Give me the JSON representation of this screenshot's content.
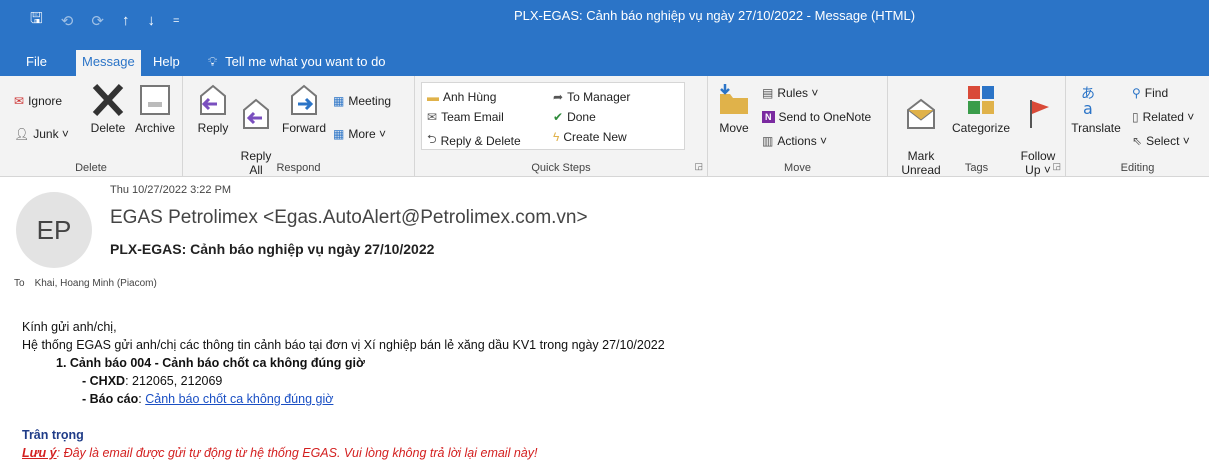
{
  "qat": {
    "save": "🖫",
    "undo": "⟲",
    "redo": "⟳",
    "up": "↑",
    "down": "↓",
    "more": "="
  },
  "window_title": "PLX-EGAS: Cảnh báo nghiệp vụ ngày 27/10/2022  -  Message (HTML)",
  "tabs": {
    "file": "File",
    "message": "Message",
    "help": "Help",
    "tell": "Tell me what you want to do"
  },
  "ribbon": {
    "delete_group": {
      "label": "Delete",
      "ignore": "Ignore",
      "junk": "Junk ˅",
      "delete": "Delete",
      "archive": "Archive"
    },
    "respond_group": {
      "label": "Respond",
      "reply": "Reply",
      "reply_all": "Reply\nAll",
      "forward": "Forward",
      "meeting": "Meeting",
      "more": "More ˅"
    },
    "quick_steps": {
      "label": "Quick Steps",
      "items": [
        "Anh Hùng",
        "Team Email",
        "Reply & Delete",
        "To Manager",
        "Done",
        "Create New"
      ]
    },
    "move_group": {
      "label": "Move",
      "move": "Move",
      "rules": "Rules ˅",
      "onenote": "Send to OneNote",
      "actions": "Actions ˅"
    },
    "tags_group": {
      "label": "Tags",
      "mark_unread": "Mark\nUnread",
      "categorize": "Categorize",
      "follow_up": "Follow\nUp ˅"
    },
    "editing_group": {
      "label": "Editing",
      "translate": "Translate",
      "find": "Find",
      "related": "Related ˅",
      "select": "Select ˅"
    }
  },
  "header": {
    "avatar": "EP",
    "date": "Thu 10/27/2022 3:22 PM",
    "from": "EGAS Petrolimex <Egas.AutoAlert@Petrolimex.com.vn>",
    "subject": "PLX-EGAS: Cảnh báo nghiệp vụ ngày 27/10/2022",
    "to_label": "To",
    "to": "Khai, Hoang Minh (Piacom)"
  },
  "body": {
    "greeting": "Kính gửi anh/chị,",
    "intro": "Hệ thống EGAS gửi anh/chị các thông tin cảnh báo tại đơn vị Xí nghiệp bán lẻ xăng dầu KV1 trong ngày 27/10/2022",
    "alert_title": "1. Cảnh báo 004 - Cảnh báo chốt ca không đúng giờ",
    "chxd_label": "- CHXD",
    "chxd_value": ": 212065, 212069",
    "report_label": "- Báo cáo",
    "report_sep": ": ",
    "report_link": "Cảnh báo chốt ca không đúng giờ",
    "closing": "Trân trọng",
    "note_label": "Lưu ý",
    "note_text": ": Đây là email được gửi tự động từ hệ thống EGAS. Vui lòng không trả lời lại email này!"
  }
}
